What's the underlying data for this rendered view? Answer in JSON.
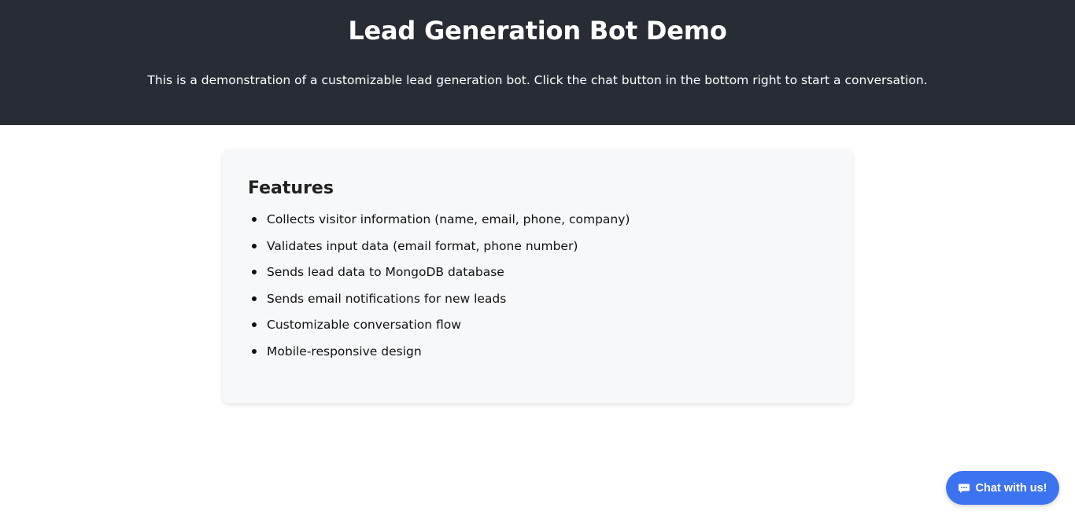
{
  "header": {
    "title": "Lead Generation Bot Demo",
    "description": "This is a demonstration of a customizable lead generation bot. Click the chat button in the bottom right to start a conversation."
  },
  "features": {
    "heading": "Features",
    "items": [
      "Collects visitor information (name, email, phone, company)",
      "Validates input data (email format, phone number)",
      "Sends lead data to MongoDB database",
      "Sends email notifications for new leads",
      "Customizable conversation flow",
      "Mobile-responsive design"
    ]
  },
  "chat_button": {
    "label": "Chat with us!",
    "icon": "chat-bubble-icon"
  },
  "colors": {
    "header_bg": "#282c34",
    "card_bg": "#f7f8fa",
    "accent": "#3b74ee"
  }
}
